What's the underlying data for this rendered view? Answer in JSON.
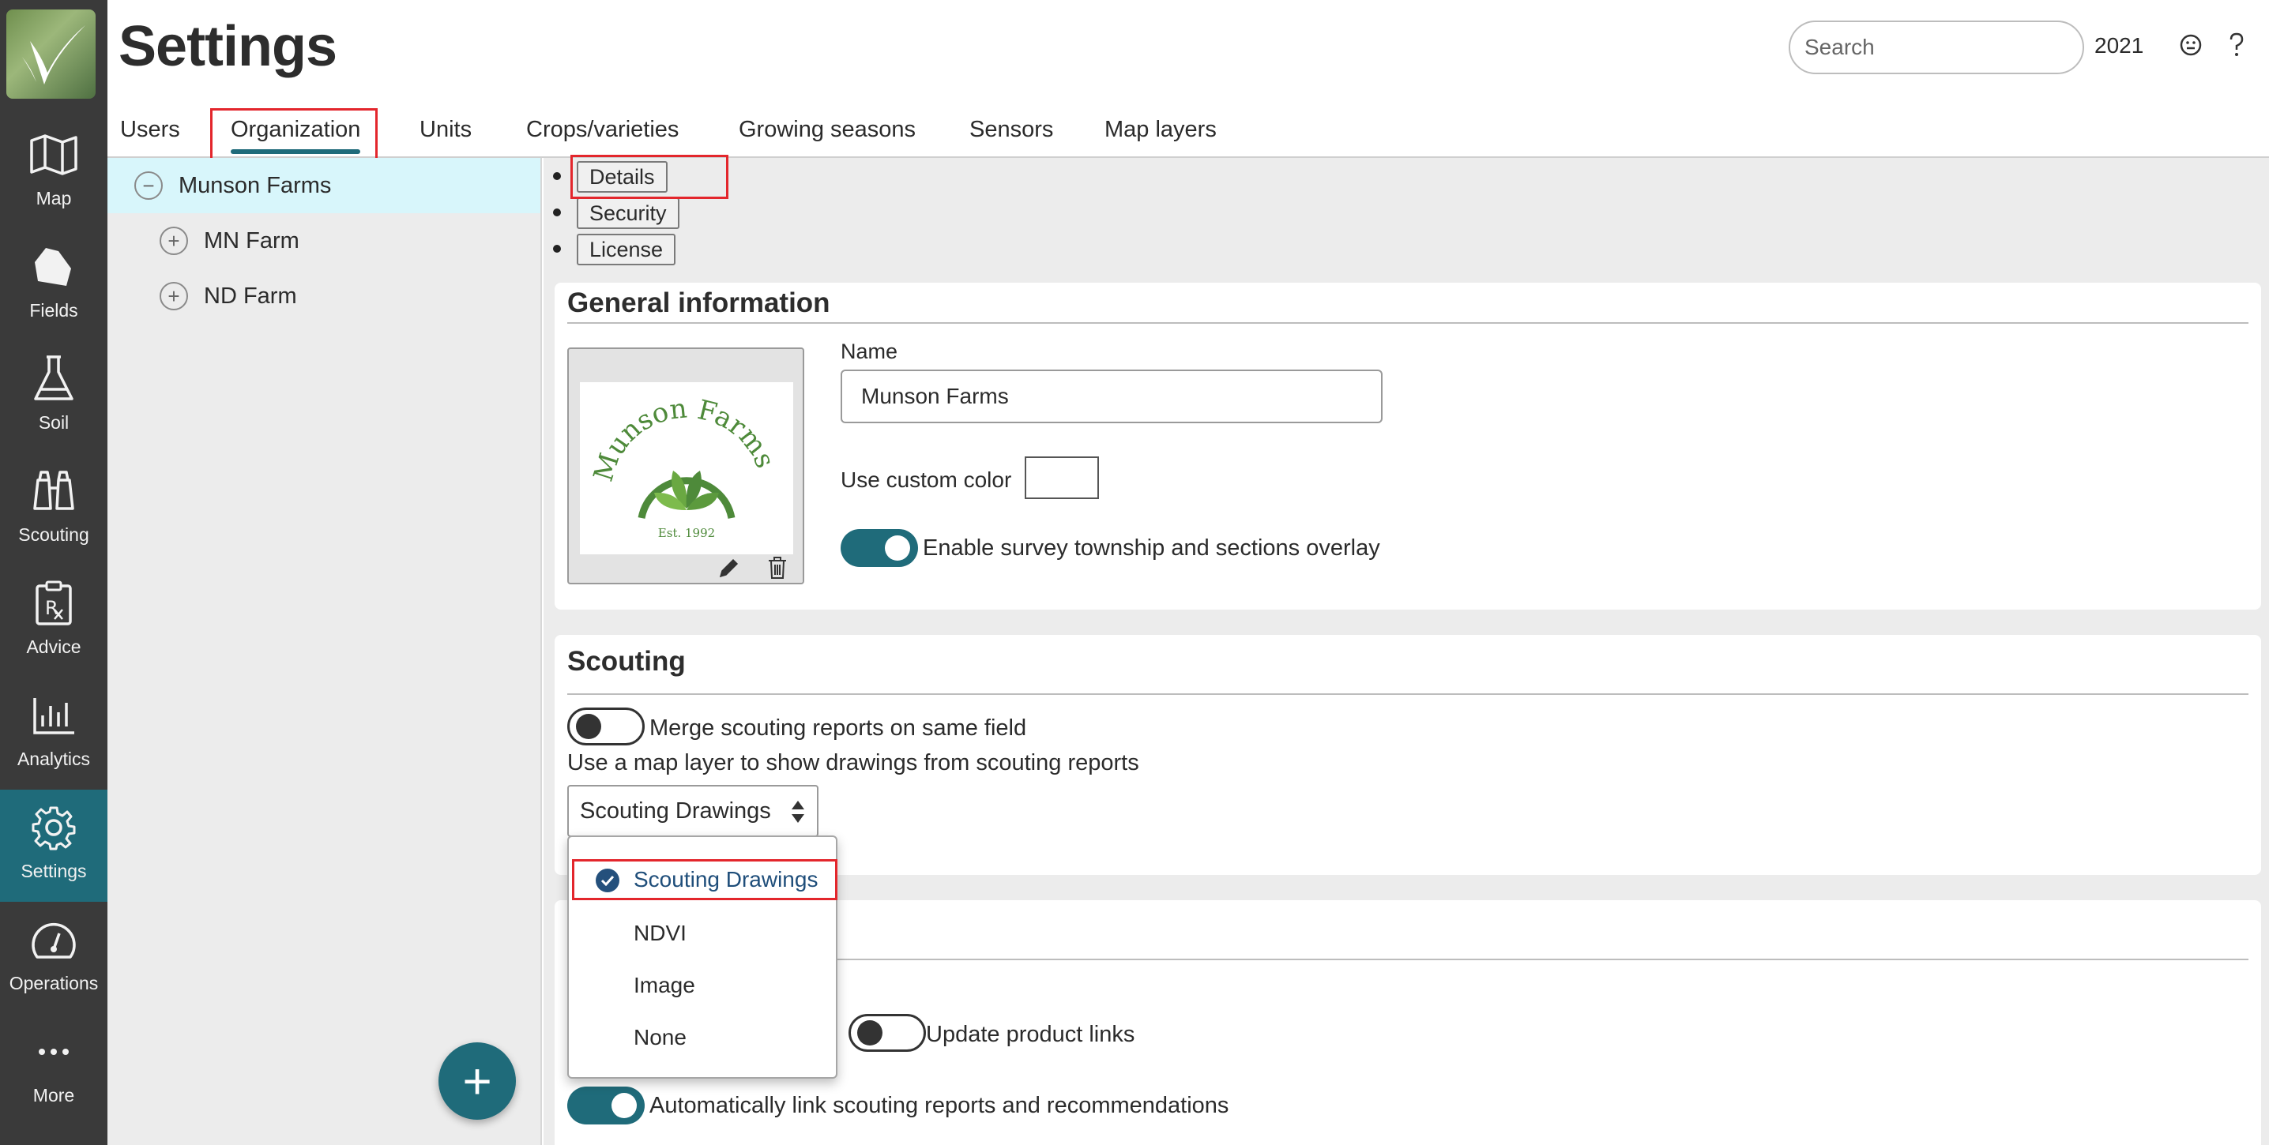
{
  "app": {
    "title": "Settings",
    "year": "2021"
  },
  "search": {
    "placeholder": "Search"
  },
  "nav": [
    {
      "label": "Map",
      "icon": "map-icon"
    },
    {
      "label": "Fields",
      "icon": "field-icon"
    },
    {
      "label": "Soil",
      "icon": "flask-icon"
    },
    {
      "label": "Scouting",
      "icon": "binoculars-icon"
    },
    {
      "label": "Advice",
      "icon": "prescription-icon"
    },
    {
      "label": "Analytics",
      "icon": "bar-chart-icon"
    },
    {
      "label": "Settings",
      "icon": "gear-icon",
      "active": true
    },
    {
      "label": "Operations",
      "icon": "gauge-icon"
    },
    {
      "label": "More",
      "icon": "more-icon"
    }
  ],
  "tabs": [
    "Users",
    "Organization",
    "Units",
    "Crops/varieties",
    "Growing seasons",
    "Sensors",
    "Map layers"
  ],
  "active_tab": "Organization",
  "tree": {
    "root": "Munson Farms",
    "children": [
      "MN Farm",
      "ND Farm"
    ]
  },
  "subnav": [
    "Details",
    "Security",
    "License"
  ],
  "general": {
    "heading": "General information",
    "logo_text": "Munson Farms",
    "logo_est": "Est. 1992",
    "name_label": "Name",
    "name_value": "Munson Farms",
    "color_label": "Use custom color",
    "survey_toggle_label": "Enable survey township and sections overlay",
    "survey_toggle_on": true
  },
  "scouting": {
    "heading": "Scouting",
    "merge_label": "Merge scouting reports on same field",
    "merge_on": false,
    "map_layer_label": "Use a map layer to show drawings from scouting reports",
    "select_value": "Scouting Drawings",
    "options": [
      "Scouting Drawings",
      "NDVI",
      "Image",
      "None"
    ],
    "selected_option": "Scouting Drawings"
  },
  "links": {
    "update_label": "Update product links",
    "update_on": false,
    "auto_label": "Automatically link scouting reports and recommendations",
    "auto_on": true
  },
  "colors": {
    "accent": "#1f6b7a",
    "rail": "#3a3a3a",
    "highlight": "#e3262c",
    "selected_row": "#d8f6fb"
  }
}
